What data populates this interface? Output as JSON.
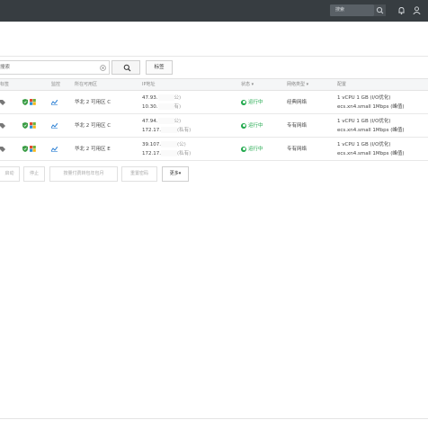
{
  "topbar": {
    "search_placeholder": "搜索",
    "bg_color": "#373d41"
  },
  "toolbar": {
    "search_placeholder": "搜索",
    "tag_button": "标签"
  },
  "table": {
    "headers": {
      "instance": "标签",
      "monitor": "监控",
      "zone": "所在可用区",
      "ip": "IP地址",
      "status": "状态 ▾",
      "network": "网络类型 ▾",
      "config": "配置"
    },
    "rows": [
      {
        "zone": "华北 2 可用区 C",
        "ip_public": "47.93.",
        "ip_public_suffix": "公)",
        "ip_private": "10.30.",
        "ip_private_suffix": "有)",
        "status": "运行中",
        "network": "经典网络",
        "config_line1": "1 vCPU 1 GB (I/O优化)",
        "config_line2": "ecs.xn4.small   1Mbps (峰值)"
      },
      {
        "zone": "华北 2 可用区 C",
        "ip_public": "47.94.",
        "ip_public_suffix": "公)",
        "ip_private": "172.17.",
        "ip_private_suffix": "(私有)",
        "status": "运行中",
        "network": "专有网络",
        "config_line1": "1 vCPU 1 GB (I/O优化)",
        "config_line2": "ecs.xn4.small   1Mbps (峰值)"
      },
      {
        "zone": "华北 2 可用区 E",
        "ip_public": "39.107.",
        "ip_public_suffix": "(公)",
        "ip_private": "172.17.",
        "ip_private_suffix": "(私有)",
        "status": "运行中",
        "network": "专有网络",
        "config_line1": "1 vCPU 1 GB (I/O优化)",
        "config_line2": "ecs.xn4.small   1Mbps (峰值)"
      }
    ]
  },
  "bottom_actions": {
    "start": "启动",
    "stop": "停止",
    "renew": "按量付费转包年包月",
    "reset_password": "重置密码",
    "more": "更多▾"
  },
  "colors": {
    "status_green": "#1fa84b",
    "chart_blue": "#2a7fd4"
  }
}
